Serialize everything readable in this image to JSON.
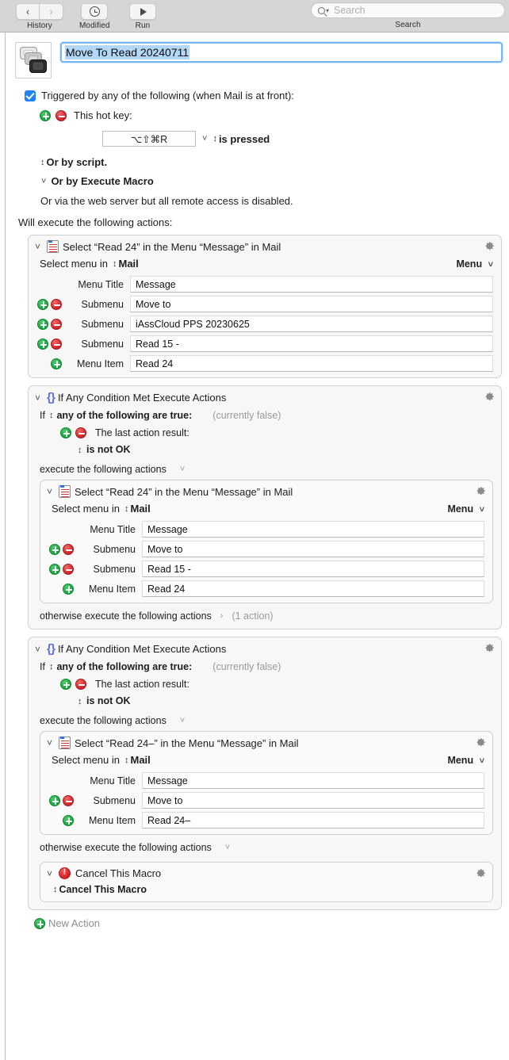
{
  "toolbar": {
    "back_icon": "chevron-left-icon",
    "forward_icon": "chevron-right-icon",
    "history_label": "History",
    "modified_label": "Modified",
    "run_label": "Run",
    "search_label": "Search",
    "search_placeholder": "Search",
    "search_value": ""
  },
  "macro": {
    "icon_name": "move-to-stack-icon",
    "title": "Move To Read 20240711",
    "trigger_checkbox_checked": true,
    "trigger_label": "Triggered by any of the following (when Mail is at front):",
    "hotkey_row_label": "This hot key:",
    "hotkey_value": "⌥⇧⌘R",
    "hotkey_condition": "is pressed",
    "or_by_script": "Or by script.",
    "or_by_execute_macro": "Or by Execute Macro",
    "web_server_note": "Or via the web server but all remote access is disabled.",
    "will_execute": "Will execute the following actions:",
    "new_action_label": "New Action"
  },
  "action1": {
    "title": "Select “Read 24” in the Menu “Message” in Mail",
    "select_menu_in": "Select menu in",
    "app": "Mail",
    "right_popup": "Menu",
    "fields": [
      {
        "label": "Menu Title",
        "value": "Message",
        "has_plus": false,
        "has_minus": false
      },
      {
        "label": "Submenu",
        "value": "Move to",
        "has_plus": true,
        "has_minus": true
      },
      {
        "label": "Submenu",
        "value": "iAssCloud PPS 20230625",
        "has_plus": true,
        "has_minus": true
      },
      {
        "label": "Submenu",
        "value": "Read 15 -",
        "has_plus": true,
        "has_minus": true
      },
      {
        "label": "Menu Item",
        "value": "Read 24",
        "has_plus": true,
        "has_minus": false
      }
    ]
  },
  "action2": {
    "title": "If Any Condition Met Execute Actions",
    "if_label": "If",
    "if_mode": "any of the following are true:",
    "currently": "(currently false)",
    "condition_label": "The last action result:",
    "condition_value": "is not OK",
    "execute_label": "execute the following actions",
    "otherwise_label": "otherwise execute the following actions",
    "otherwise_count": "(1 action)",
    "inner": {
      "title": "Select “Read 24” in the Menu “Message” in Mail",
      "select_menu_in": "Select menu in",
      "app": "Mail",
      "right_popup": "Menu",
      "fields": [
        {
          "label": "Menu Title",
          "value": "Message",
          "has_plus": false,
          "has_minus": false
        },
        {
          "label": "Submenu",
          "value": "Move to",
          "has_plus": true,
          "has_minus": true
        },
        {
          "label": "Submenu",
          "value": "Read 15 -",
          "has_plus": true,
          "has_minus": true
        },
        {
          "label": "Menu Item",
          "value": "Read 24",
          "has_plus": true,
          "has_minus": false
        }
      ]
    }
  },
  "action3": {
    "title": "If Any Condition Met Execute Actions",
    "if_label": "If",
    "if_mode": "any of the following are true:",
    "currently": "(currently false)",
    "condition_label": "The last action result:",
    "condition_value": "is not OK",
    "execute_label": "execute the following actions",
    "otherwise_label": "otherwise execute the following actions",
    "inner": {
      "title": "Select “Read 24–” in the Menu “Message” in Mail",
      "select_menu_in": "Select menu in",
      "app": "Mail",
      "right_popup": "Menu",
      "fields": [
        {
          "label": "Menu Title",
          "value": "Message",
          "has_plus": false,
          "has_minus": false
        },
        {
          "label": "Submenu",
          "value": "Move to",
          "has_plus": true,
          "has_minus": true
        },
        {
          "label": "Menu Item",
          "value": "Read 24–",
          "has_plus": true,
          "has_minus": false
        }
      ]
    },
    "cancel": {
      "title": "Cancel This Macro",
      "body": "Cancel This Macro"
    }
  },
  "colors": {
    "accent_blue": "#1f84f5",
    "selection_blue": "#b2d7f7",
    "add_green": "#18a33f",
    "remove_red": "#cc2427",
    "brace_purple": "#5b6ee8",
    "stop_red": "#d0201f",
    "toolbar_gray": "#d6d6d6"
  }
}
